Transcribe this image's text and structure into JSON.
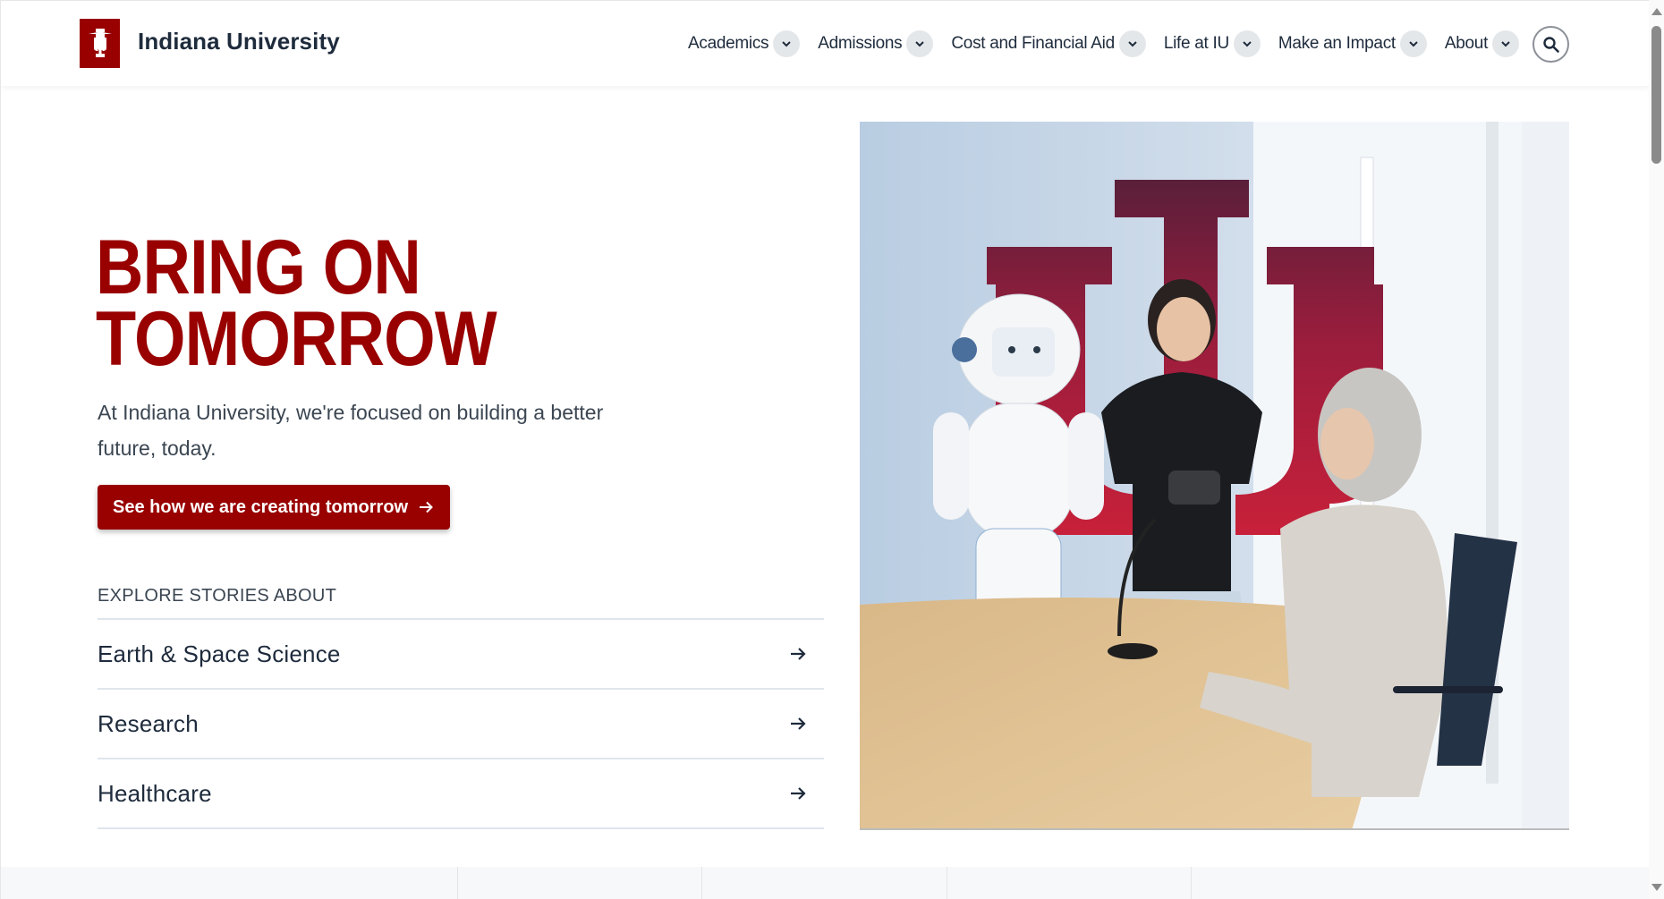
{
  "header": {
    "brand": "Indiana University",
    "logo_icon": "iu-trident-icon",
    "nav": [
      {
        "label": "Academics"
      },
      {
        "label": "Admissions"
      },
      {
        "label": "Cost and Financial Aid"
      },
      {
        "label": "Life at IU"
      },
      {
        "label": "Make an Impact"
      },
      {
        "label": "About"
      }
    ],
    "search_icon": "search-icon"
  },
  "hero": {
    "title_line1": "BRING ON",
    "title_line2": "TOMORROW",
    "text": "At Indiana University, we're focused on building a better future, today.",
    "cta_label": "See how we are creating tomorrow",
    "image_alt": "Student demonstrating a robot to an older woman in front of an IU trident with circuit pattern"
  },
  "explore": {
    "label": "EXPLORE STORIES ABOUT",
    "items": [
      {
        "label": "Earth & Space Science"
      },
      {
        "label": "Research"
      },
      {
        "label": "Healthcare"
      }
    ]
  },
  "colors": {
    "brand_red": "#990000",
    "text_dark": "#1e2b3c",
    "divider": "#dfe5ec",
    "chevron_bg": "#e4e7ea"
  }
}
